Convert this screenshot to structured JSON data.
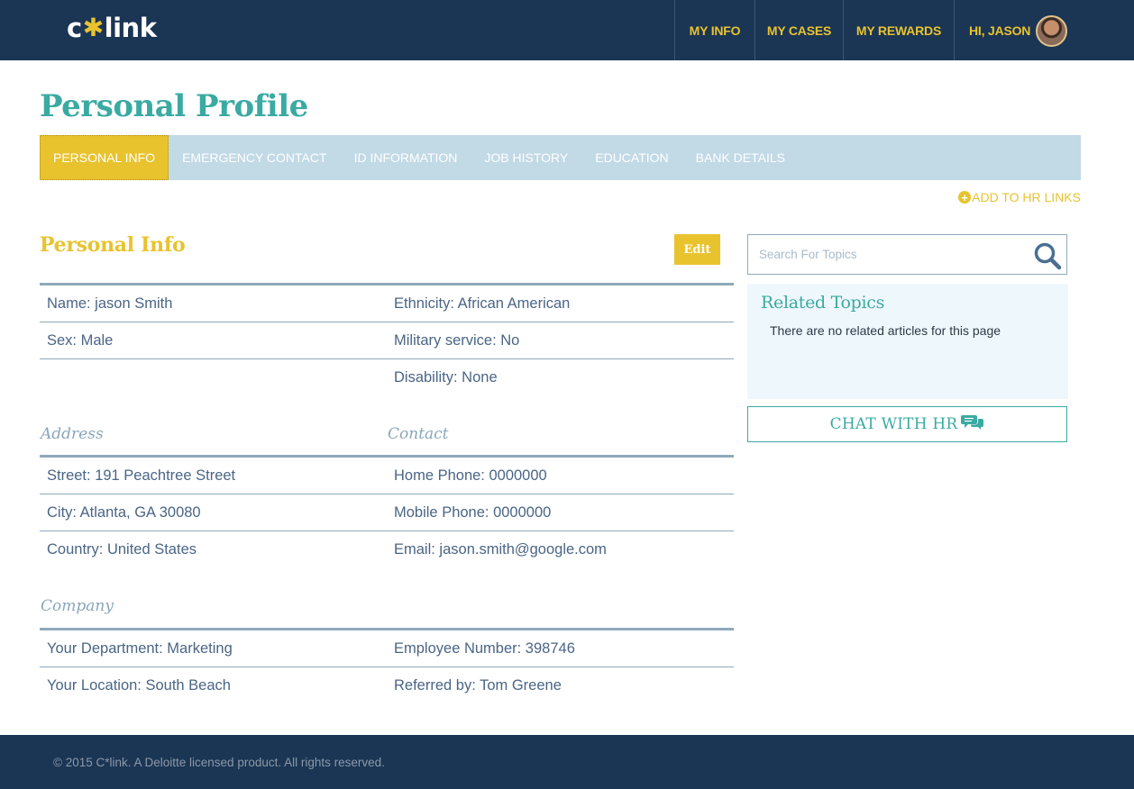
{
  "header": {
    "logo": {
      "left": "c",
      "star": "✱",
      "right": "link"
    },
    "nav": [
      {
        "label": "MY INFO"
      },
      {
        "label": "MY CASES"
      },
      {
        "label": "MY REWARDS"
      }
    ],
    "user_greeting": "HI, JASON",
    "colors": {
      "bar": "#1b3554",
      "accent": "#e8c32e"
    }
  },
  "page": {
    "title": "Personal Profile",
    "tabs": [
      {
        "label": "PERSONAL INFO",
        "active": true
      },
      {
        "label": "EMERGENCY CONTACT"
      },
      {
        "label": "ID INFORMATION"
      },
      {
        "label": "JOB HISTORY"
      },
      {
        "label": "EDUCATION"
      },
      {
        "label": "BANK DETAILS"
      }
    ],
    "add_hr_links": "ADD TO HR LINKS",
    "add_icon_glyph": "+"
  },
  "personal_info": {
    "title": "Personal Info",
    "edit_label": "Edit",
    "rows": [
      [
        "Name: jason Smith",
        "Ethnicity: African American"
      ],
      [
        "Sex: Male",
        "Military service: No"
      ],
      [
        "",
        "Disability: None"
      ]
    ],
    "address_heading": "Address",
    "contact_heading": "Contact",
    "address_rows": [
      [
        "Street: 191 Peachtree Street",
        "Home Phone: 0000000"
      ],
      [
        "City: Atlanta, GA 30080",
        "Mobile Phone: 0000000"
      ],
      [
        "Country: United States",
        "Email: jason.smith@google.com"
      ]
    ],
    "company_heading": "Company",
    "company_rows": [
      [
        "Your Department: Marketing",
        "Employee Number: 398746"
      ],
      [
        "Your Location: South Beach",
        "Referred by: Tom Greene"
      ]
    ]
  },
  "sidebar": {
    "search_placeholder": "Search For Topics",
    "search_icon": "search-icon",
    "related_title": "Related Topics",
    "related_empty": "There are no related articles for this page",
    "chat_label": "CHAT WITH HR",
    "chat_icon": "chat-bubbles-icon"
  },
  "footer": {
    "text": "© 2015 C*link. A Deloitte licensed product. All rights reserved."
  }
}
